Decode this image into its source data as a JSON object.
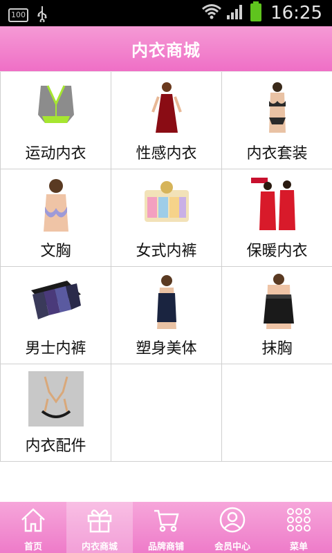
{
  "status_bar": {
    "battery": "100",
    "time": "16:25"
  },
  "header": {
    "title": "内衣商城"
  },
  "categories": [
    {
      "label": "运动内衣",
      "icon": "sports-bra-icon"
    },
    {
      "label": "性感内衣",
      "icon": "sexy-lingerie-icon"
    },
    {
      "label": "内衣套装",
      "icon": "lingerie-set-icon"
    },
    {
      "label": "文胸",
      "icon": "bra-icon"
    },
    {
      "label": "女式内裤",
      "icon": "womens-underwear-icon"
    },
    {
      "label": "保暖内衣",
      "icon": "thermal-underwear-icon"
    },
    {
      "label": "男士内裤",
      "icon": "mens-underwear-icon"
    },
    {
      "label": "塑身美体",
      "icon": "shapewear-icon"
    },
    {
      "label": "抹胸",
      "icon": "tube-top-icon"
    },
    {
      "label": "内衣配件",
      "icon": "accessories-icon"
    }
  ],
  "tab_bar": {
    "items": [
      {
        "label": "首页",
        "icon": "home-icon"
      },
      {
        "label": "内衣商城",
        "icon": "gift-icon"
      },
      {
        "label": "品牌商铺",
        "icon": "cart-icon"
      },
      {
        "label": "会员中心",
        "icon": "user-icon"
      },
      {
        "label": "菜单",
        "icon": "grid-menu-icon"
      }
    ],
    "active_index": 1
  },
  "colors": {
    "header_pink": "#ef6fc6",
    "tab_pink": "#ee7bc9"
  }
}
